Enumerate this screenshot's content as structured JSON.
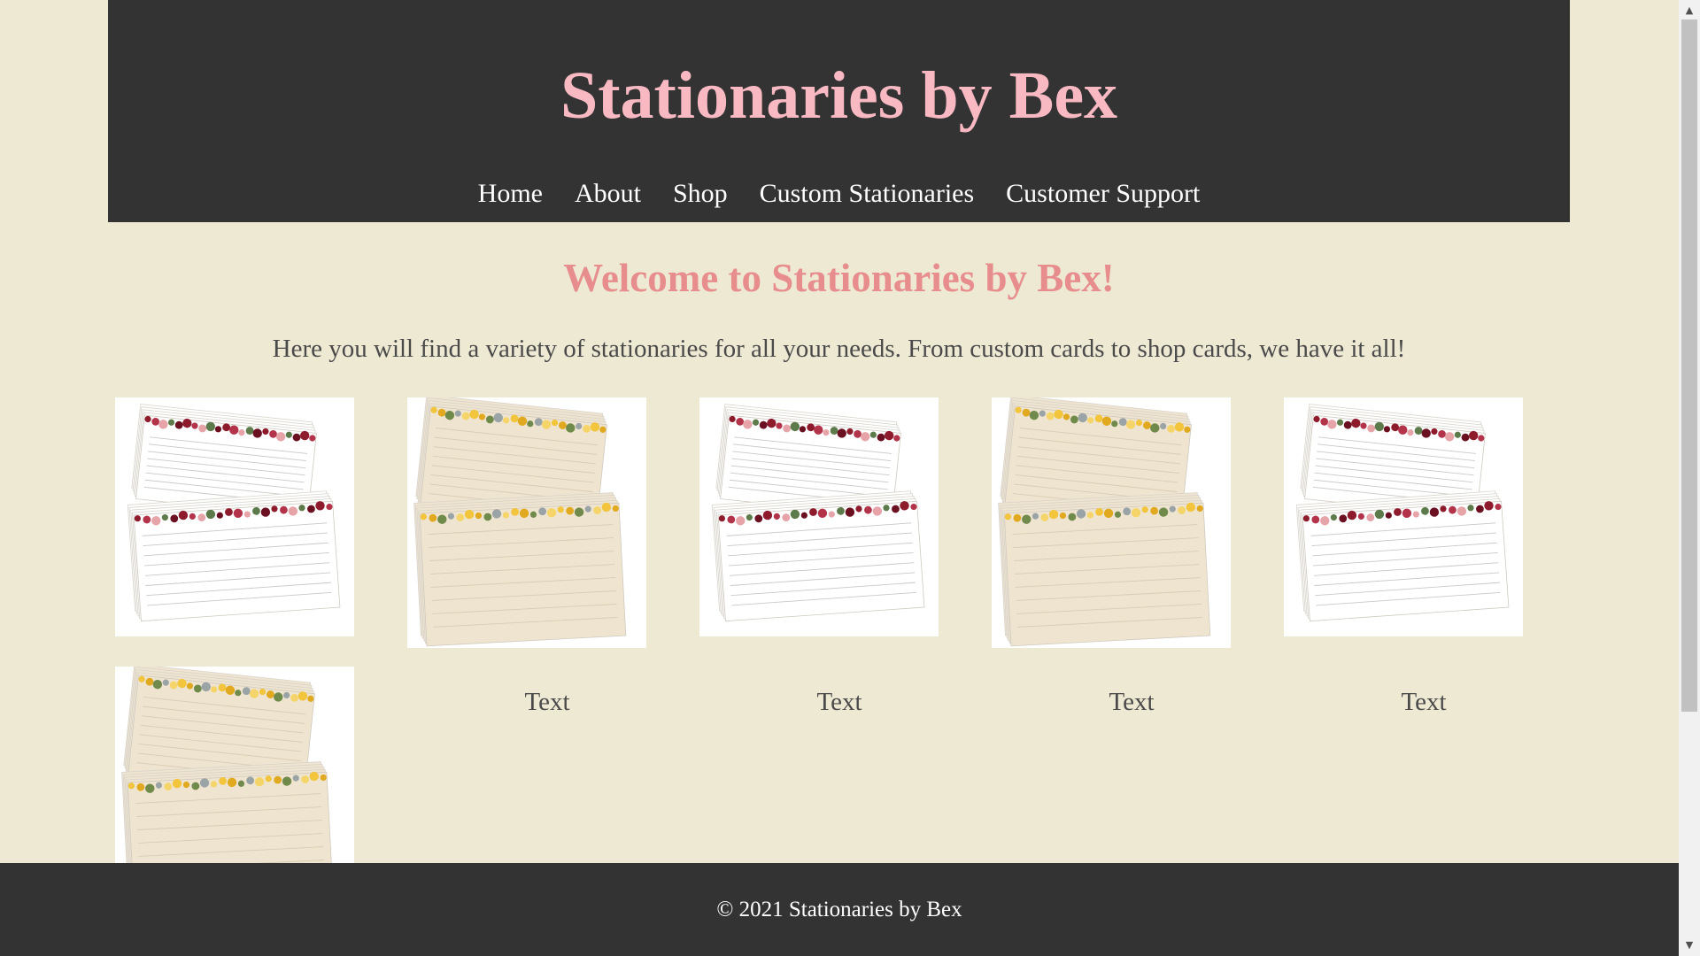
{
  "header": {
    "site_title": "Stationaries by Bex",
    "nav": [
      "Home",
      "About",
      "Shop",
      "Custom Stationaries",
      "Customer Support"
    ]
  },
  "main": {
    "welcome": "Welcome to Stationaries by Bex!",
    "intro": "Here you will find a variety of stationaries for all your needs. From custom cards to shop cards, we have it all!",
    "products": [
      {
        "style": "floral-red",
        "caption": ""
      },
      {
        "style": "sunflower",
        "caption": "Text"
      },
      {
        "style": "floral-red",
        "caption": "Text"
      },
      {
        "style": "sunflower",
        "caption": "Text"
      },
      {
        "style": "floral-red",
        "caption": "Text"
      },
      {
        "style": "sunflower",
        "caption": ""
      }
    ]
  },
  "footer": {
    "copyright": "© 2021 Stationaries by Bex"
  },
  "colors": {
    "background": "#ede9d3",
    "header_bg": "#333333",
    "title_pink": "#f9b9c3",
    "welcome_pink": "#e88d8d",
    "text_gray": "#4a4a4a"
  },
  "scrollbar": {
    "up_arrow_icon": "triangle-up-icon",
    "down_arrow_icon": "triangle-down-icon"
  }
}
